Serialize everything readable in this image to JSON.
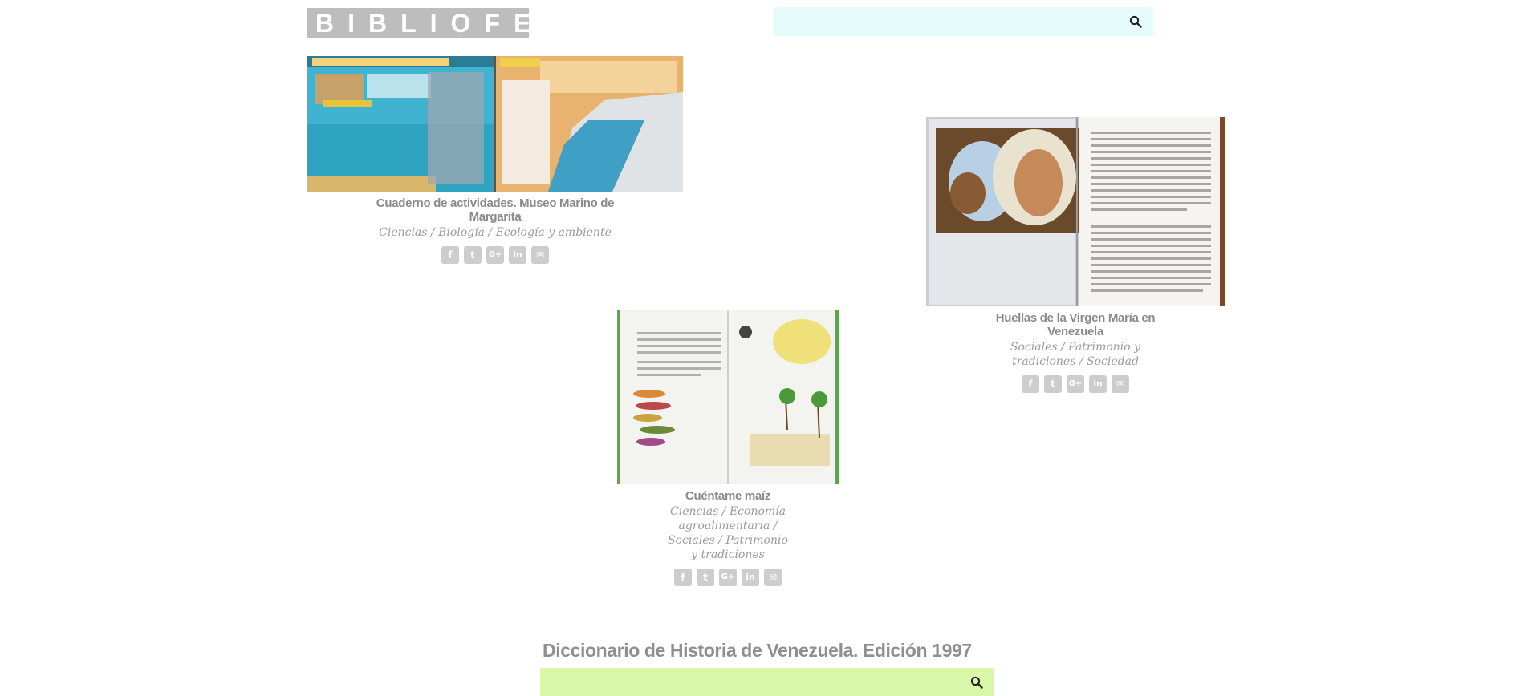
{
  "header": {
    "logo": "BIBLIOFEP",
    "search_placeholder": ""
  },
  "books": [
    {
      "title": "Cuaderno de actividades. Museo Marino de Margarita",
      "category": "Ciencias / Biología / Ecología y ambiente"
    },
    {
      "title": "Huellas de la Virgen María en Venezuela",
      "category": "Sociales / Patrimonio y tradiciones / Sociedad"
    },
    {
      "title": "Cuéntame maíz",
      "category": "Ciencias / Economía agroalimentaria / Sociales / Patrimonio y tradiciones"
    }
  ],
  "share_icons": [
    "facebook-icon",
    "twitter-icon",
    "google-plus-icon",
    "linkedin-icon",
    "email-icon"
  ],
  "share_glyphs": {
    "facebook": "f",
    "twitter": "t",
    "google_plus": "G+",
    "linkedin": "in",
    "email": "✉"
  },
  "dictionary": {
    "title": "Diccionario de Historia de Venezuela. Edición 1997",
    "search_placeholder": ""
  },
  "colors": {
    "logo_bg": "#bdbdbd",
    "top_search_bg": "#e6fbfc",
    "bottom_search_bg": "#d9f7a8",
    "text_gray": "#8a8a8a"
  }
}
